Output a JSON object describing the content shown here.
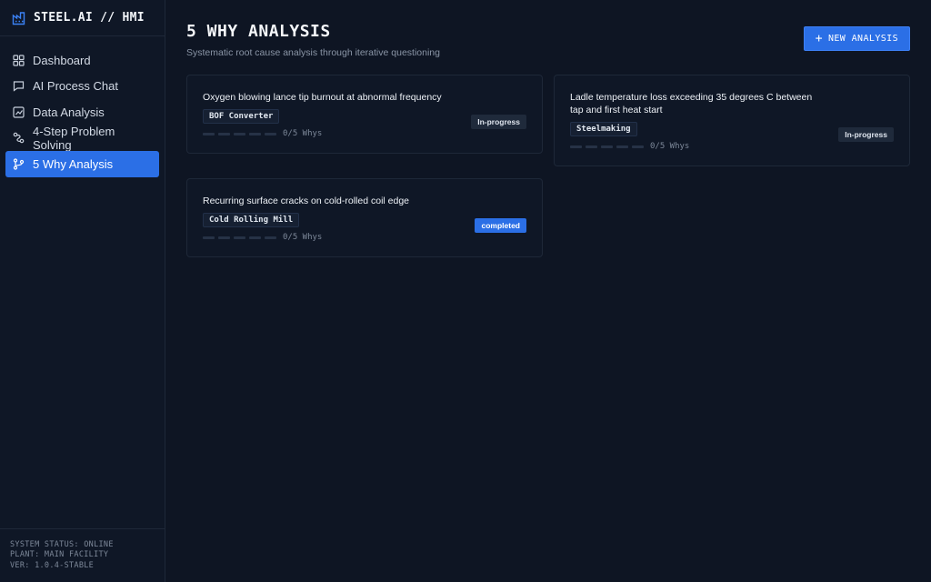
{
  "app": {
    "brand": "STEEL.AI // HMI"
  },
  "sidebar": {
    "items": [
      {
        "label": "Dashboard",
        "icon": "dashboard-icon"
      },
      {
        "label": "AI Process Chat",
        "icon": "chat-icon"
      },
      {
        "label": "Data Analysis",
        "icon": "chart-icon"
      },
      {
        "label": "4-Step Problem Solving",
        "icon": "route-icon"
      },
      {
        "label": "5 Why Analysis",
        "icon": "git-branch-icon",
        "active": true
      }
    ],
    "status": {
      "line1": "SYSTEM STATUS: ONLINE",
      "line2": "PLANT: MAIN FACILITY",
      "line3": "VER: 1.0.4-STABLE"
    }
  },
  "header": {
    "title": "5 WHY ANALYSIS",
    "subtitle": "Systematic root cause analysis through iterative questioning",
    "new_button": "NEW ANALYSIS"
  },
  "cards": [
    {
      "title": "Oxygen blowing lance tip burnout at abnormal frequency",
      "tag": "BOF Converter",
      "progress": "0/5 Whys",
      "whys_done": 0,
      "status": "In-progress"
    },
    {
      "title": "Ladle temperature loss exceeding 35 degrees C between tap and first heat start",
      "tag": "Steelmaking",
      "progress": "0/5 Whys",
      "whys_done": 0,
      "status": "In-progress"
    },
    {
      "title": "Recurring surface cracks on cold-rolled coil edge",
      "tag": "Cold Rolling Mill",
      "progress": "0/5 Whys",
      "whys_done": 0,
      "status": "completed"
    }
  ],
  "colors": {
    "accent": "#2b6fe6",
    "background": "#0e1523",
    "panel": "#0f1726"
  }
}
